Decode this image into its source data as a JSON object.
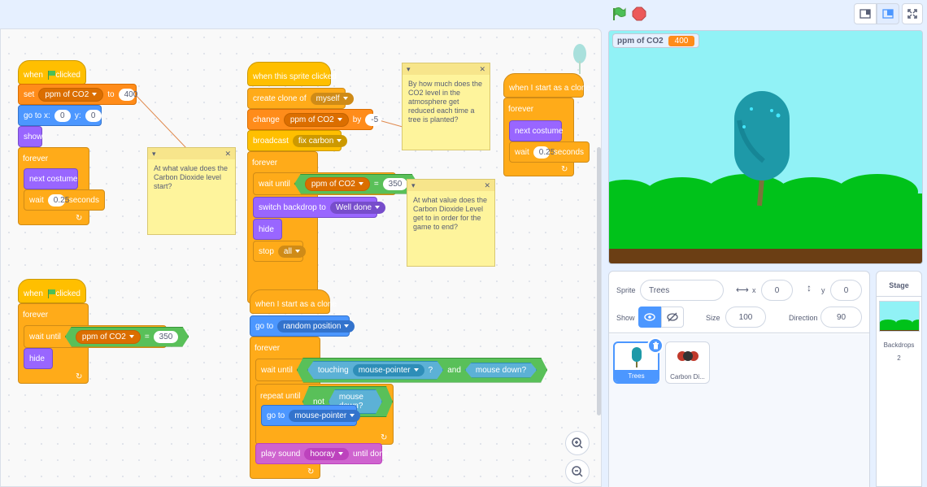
{
  "toolbar": {
    "green_flag": "green-flag-icon",
    "stop": "stop-icon"
  },
  "scripts": {
    "s1": {
      "hat_when": "when",
      "hat_clicked": "clicked",
      "set": "set",
      "set_var": "ppm of CO2",
      "set_to": "to",
      "set_val": "400",
      "goto": "go to x:",
      "x": "0",
      "y_lbl": "y:",
      "y": "0",
      "show": "show",
      "forever": "forever",
      "next_costume": "next costume",
      "wait": "wait",
      "wait_val": "0.25",
      "seconds": "seconds"
    },
    "s2": {
      "hat": "when this sprite clicked",
      "create_clone": "create clone of",
      "clone_target": "myself",
      "change": "change",
      "change_var": "ppm of CO2",
      "by": "by",
      "by_val": "-5",
      "broadcast": "broadcast",
      "broadcast_msg": "fix carbon",
      "forever": "forever",
      "wait_until": "wait until",
      "cmp_var": "ppm of CO2",
      "eq": "=",
      "cmp_val": "350",
      "switch_backdrop": "switch backdrop to",
      "backdrop": "Well done",
      "hide": "hide",
      "stop": "stop",
      "stop_opt": "all"
    },
    "s3": {
      "hat": "when I start as a clone",
      "forever": "forever",
      "next_costume": "next costume",
      "wait": "wait",
      "wait_val": "0.25",
      "seconds": "seconds"
    },
    "s4": {
      "hat_when": "when",
      "hat_clicked": "clicked",
      "forever": "forever",
      "wait_until": "wait until",
      "cmp_var": "ppm of CO2",
      "eq": "=",
      "cmp_val": "350",
      "hide": "hide"
    },
    "s5": {
      "hat": "when I start as a clone",
      "goto": "go to",
      "goto_target": "random position",
      "forever": "forever",
      "wait_until": "wait until",
      "touching": "touching",
      "touch_target": "mouse-pointer",
      "q": "?",
      "and": "and",
      "mouse_down": "mouse down?",
      "repeat_until": "repeat until",
      "not": "not",
      "mouse_down2": "mouse down?",
      "goto2": "go to",
      "goto2_target": "mouse-pointer",
      "play_sound": "play sound",
      "sound": "hooray",
      "until_done": "until done"
    }
  },
  "notes": {
    "n1": "At what value does the Carbon Dioxide level start?",
    "n2": "By how much does the CO2 level in the atmosphere get reduced each time a tree is planted?",
    "n3": "At what value does the Carbon Dioxide Level get to in order for the game to end?"
  },
  "stage": {
    "monitor_label": "ppm of CO2",
    "monitor_value": "400"
  },
  "sprite_info": {
    "sprite_label": "Sprite",
    "sprite_name": "Trees",
    "x_label": "x",
    "x_value": "0",
    "y_label": "y",
    "y_value": "0",
    "show_label": "Show",
    "size_label": "Size",
    "size_value": "100",
    "direction_label": "Direction",
    "direction_value": "90"
  },
  "sprites": [
    {
      "name": "Trees"
    },
    {
      "name": "Carbon Di..."
    }
  ],
  "stage_panel": {
    "title": "Stage",
    "backdrops_label": "Backdrops",
    "backdrops_count": "2"
  },
  "colors": {
    "accent": "#4c97ff",
    "event": "#ffbf00",
    "control": "#ffab19",
    "variable": "#ff8c1a",
    "motion": "#4c97ff",
    "looks": "#9966ff",
    "sound": "#cf63cf",
    "operator": "#59c059",
    "sensing": "#5cb1d6"
  }
}
